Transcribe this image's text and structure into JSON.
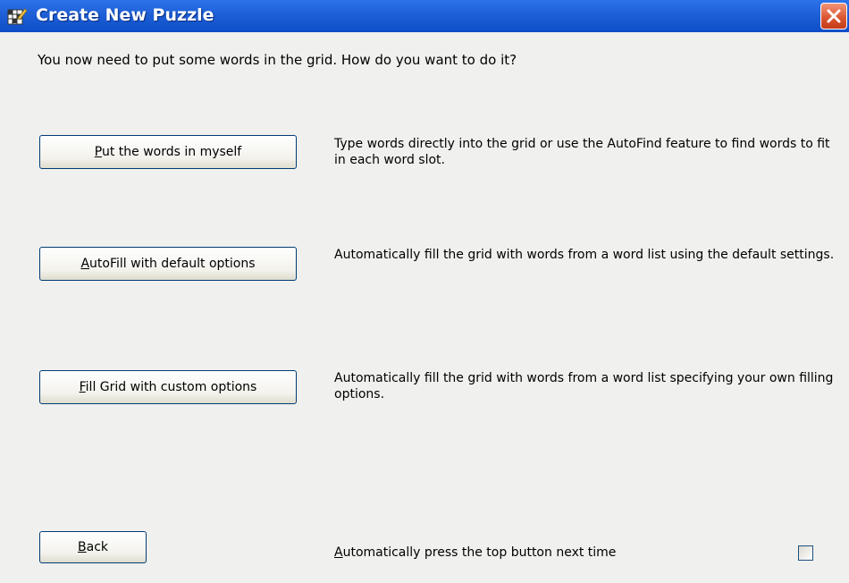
{
  "window": {
    "title": "Create New Puzzle",
    "title_icon": "puzzle-grid-icon",
    "close_icon": "close-icon",
    "titlebar_color": "#0d4ec8",
    "close_color": "#d9532f"
  },
  "intro_text": "You now need to put some words in the grid. How do you want to do it?",
  "options": [
    {
      "hotkey": "P",
      "label_rest": "ut the words in myself",
      "description": "Type words directly into the grid or use the AutoFind feature to find words to fit in each word slot."
    },
    {
      "hotkey": "A",
      "label_rest": "utoFill with default options",
      "description": "Automatically fill the grid with words from a word list using the default settings."
    },
    {
      "hotkey": "F",
      "label_rest": "ill Grid with custom options",
      "description": "Automatically fill the grid with words from a word list specifying your own filling options."
    }
  ],
  "back_button": {
    "hotkey": "B",
    "label_rest": "ack"
  },
  "auto_press": {
    "hotkey": "A",
    "label_rest": "utomatically press the top button next time",
    "checked": false
  }
}
